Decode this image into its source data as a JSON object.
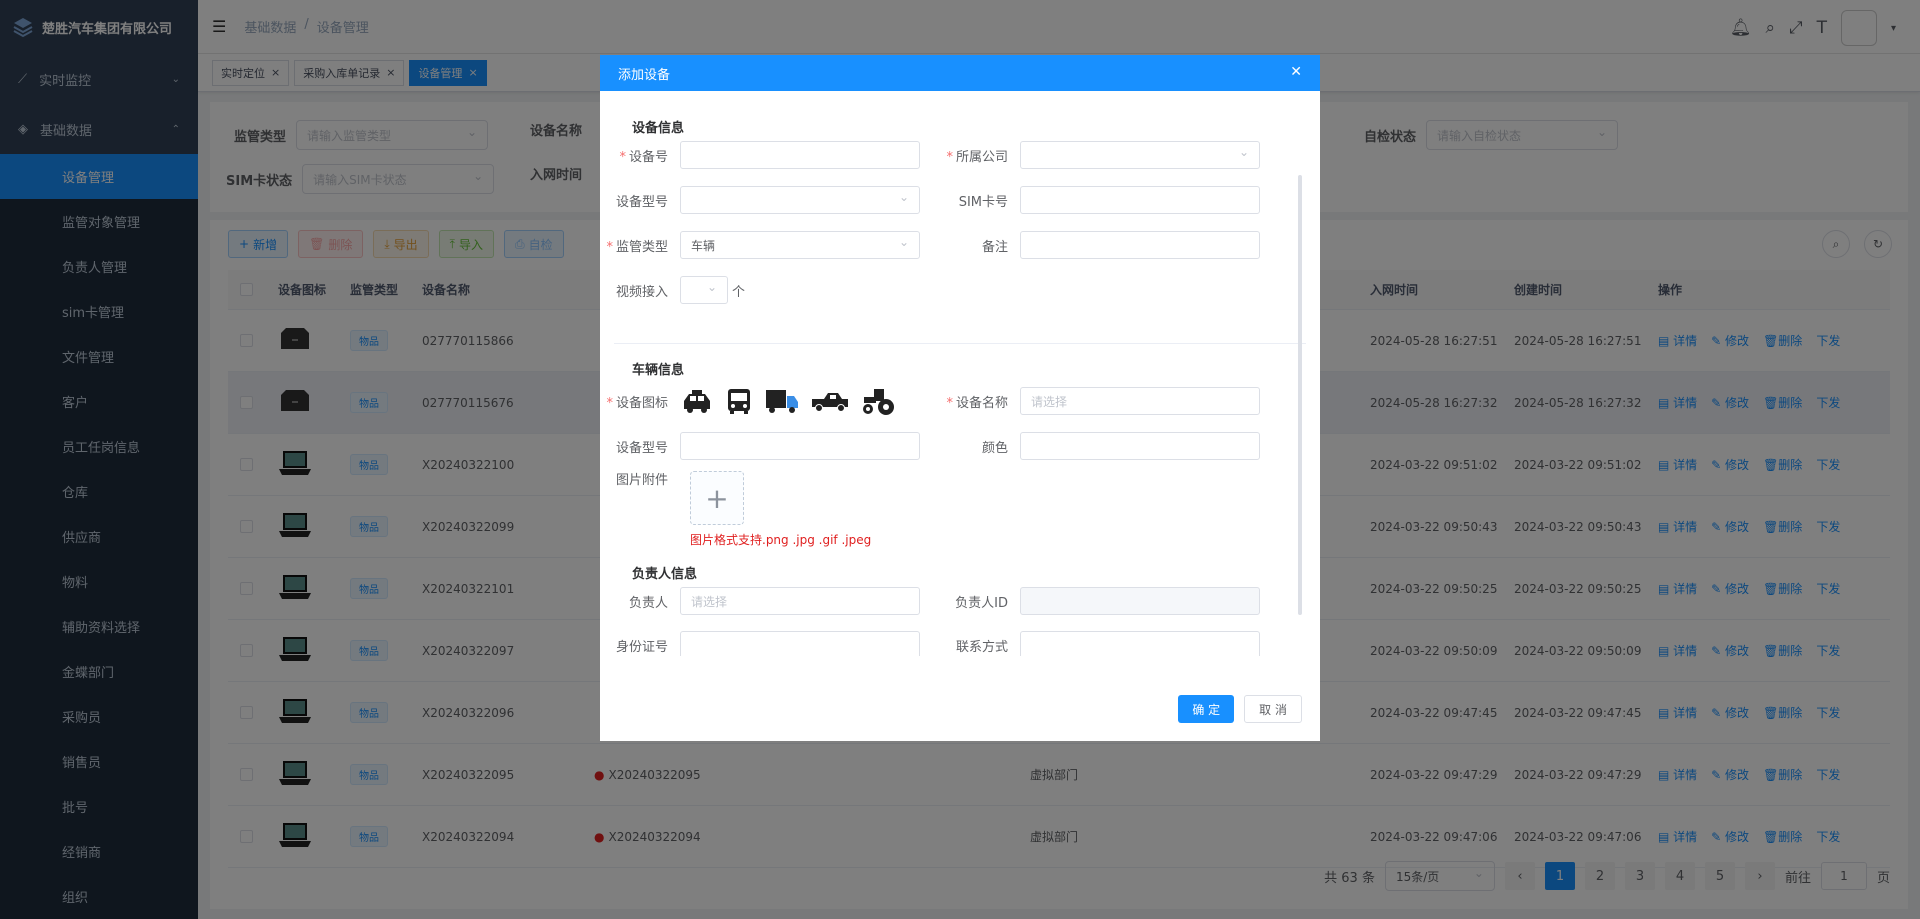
{
  "brand": {
    "name": "楚胜汽车集团有限公司"
  },
  "sidebar": {
    "groups": [
      {
        "label": "实时监控",
        "icon": "chart-line-icon"
      },
      {
        "label": "基础数据",
        "icon": "layers-icon"
      }
    ],
    "items": [
      {
        "label": "设备管理"
      },
      {
        "label": "监管对象管理"
      },
      {
        "label": "负责人管理"
      },
      {
        "label": "sim卡管理"
      },
      {
        "label": "文件管理"
      },
      {
        "label": "客户"
      },
      {
        "label": "员工任岗信息"
      },
      {
        "label": "仓库"
      },
      {
        "label": "供应商"
      },
      {
        "label": "物料"
      },
      {
        "label": "辅助资料选择"
      },
      {
        "label": "金蝶部门"
      },
      {
        "label": "采购员"
      },
      {
        "label": "销售员"
      },
      {
        "label": "批号"
      },
      {
        "label": "经销商"
      },
      {
        "label": "组织"
      }
    ]
  },
  "header": {
    "crumb1": "基础数据",
    "sep": "/",
    "crumb2": "设备管理"
  },
  "tags": [
    {
      "label": "实时定位"
    },
    {
      "label": "采购入库单记录"
    },
    {
      "label": "设备管理"
    }
  ],
  "filter": {
    "type_label": "监管类型",
    "type_ph": "请输入监管类型",
    "name_label": "设备名称",
    "sim_label": "SIM卡状态",
    "sim_ph": "请输入SIM卡状态",
    "net_label": "入网时间",
    "check_label": "自检状态",
    "check_ph": "请输入自检状态"
  },
  "toolbar": {
    "add": "新增",
    "del": "删除",
    "export": "导出",
    "import": "导入",
    "self": "自检"
  },
  "table": {
    "headers": {
      "icon": "设备图标",
      "type": "监管类型",
      "name": "设备名称",
      "net": "入网时间",
      "created": "创建时间",
      "ops": "操作"
    },
    "ops": {
      "detail": "详情",
      "edit": "修改",
      "del": "删除",
      "issue": "下发"
    },
    "rows": [
      {
        "name": "027770115866",
        "badge": "物品",
        "net": "2024-05-28 16:27:51",
        "created": "2024-05-28 16:27:51"
      },
      {
        "name": "027770115676",
        "badge": "物品",
        "net": "2024-05-28 16:27:32",
        "created": "2024-05-28 16:27:32"
      },
      {
        "name": "X20240322100",
        "badge": "物品",
        "net": "2024-03-22 09:51:02",
        "created": "2024-03-22 09:51:02"
      },
      {
        "name": "X20240322099",
        "badge": "物品",
        "net": "2024-03-22 09:50:43",
        "created": "2024-03-22 09:50:43"
      },
      {
        "name": "X20240322101",
        "badge": "物品",
        "net": "2024-03-22 09:50:25",
        "created": "2024-03-22 09:50:25"
      },
      {
        "name": "X20240322097",
        "badge": "物品",
        "net": "2024-03-22 09:50:09",
        "created": "2024-03-22 09:50:09"
      },
      {
        "name": "X20240322096",
        "badge": "物品",
        "net": "2024-03-22 09:47:45",
        "created": "2024-03-22 09:47:45"
      },
      {
        "name": "X20240322095",
        "badge": "物品",
        "name2": "X20240322095",
        "dept": "虚拟部门",
        "net": "2024-03-22 09:47:29",
        "created": "2024-03-22 09:47:29"
      },
      {
        "name": "X20240322094",
        "badge": "物品",
        "name2": "X20240322094",
        "dept": "虚拟部门",
        "net": "2024-03-22 09:47:06",
        "created": "2024-03-22 09:47:06"
      }
    ]
  },
  "pager": {
    "total": "共 63 条",
    "size": "15条/页",
    "pages": [
      "1",
      "2",
      "3",
      "4",
      "5"
    ],
    "goto": "前往",
    "page_val": "1",
    "unit": "页"
  },
  "dialog": {
    "title": "添加设备",
    "sec_device": "设备信息",
    "device_no": "设备号",
    "company": "所属公司",
    "model": "设备型号",
    "sim_no": "SIM卡号",
    "sup_type": "监管类型",
    "sup_type_val": "车辆",
    "remark": "备注",
    "video": "视频接入",
    "video_unit": "个",
    "sec_vehicle": "车辆信息",
    "icon_label": "设备图标",
    "dev_name": "设备名称",
    "dev_name_ph": "请选择",
    "veh_model": "设备型号",
    "color": "颜色",
    "attach": "图片附件",
    "attach_hint": "图片格式支持.png .jpg .gif .jpeg",
    "sec_owner": "负责人信息",
    "owner": "负责人",
    "owner_ph": "请选择",
    "owner_id": "负责人ID",
    "id_card": "身份证号",
    "contact": "联系方式",
    "ok": "确 定",
    "cancel": "取 消"
  },
  "colors": {
    "primary": "#1890ff",
    "sidebar": "#304156",
    "danger": "#f56c6c"
  }
}
